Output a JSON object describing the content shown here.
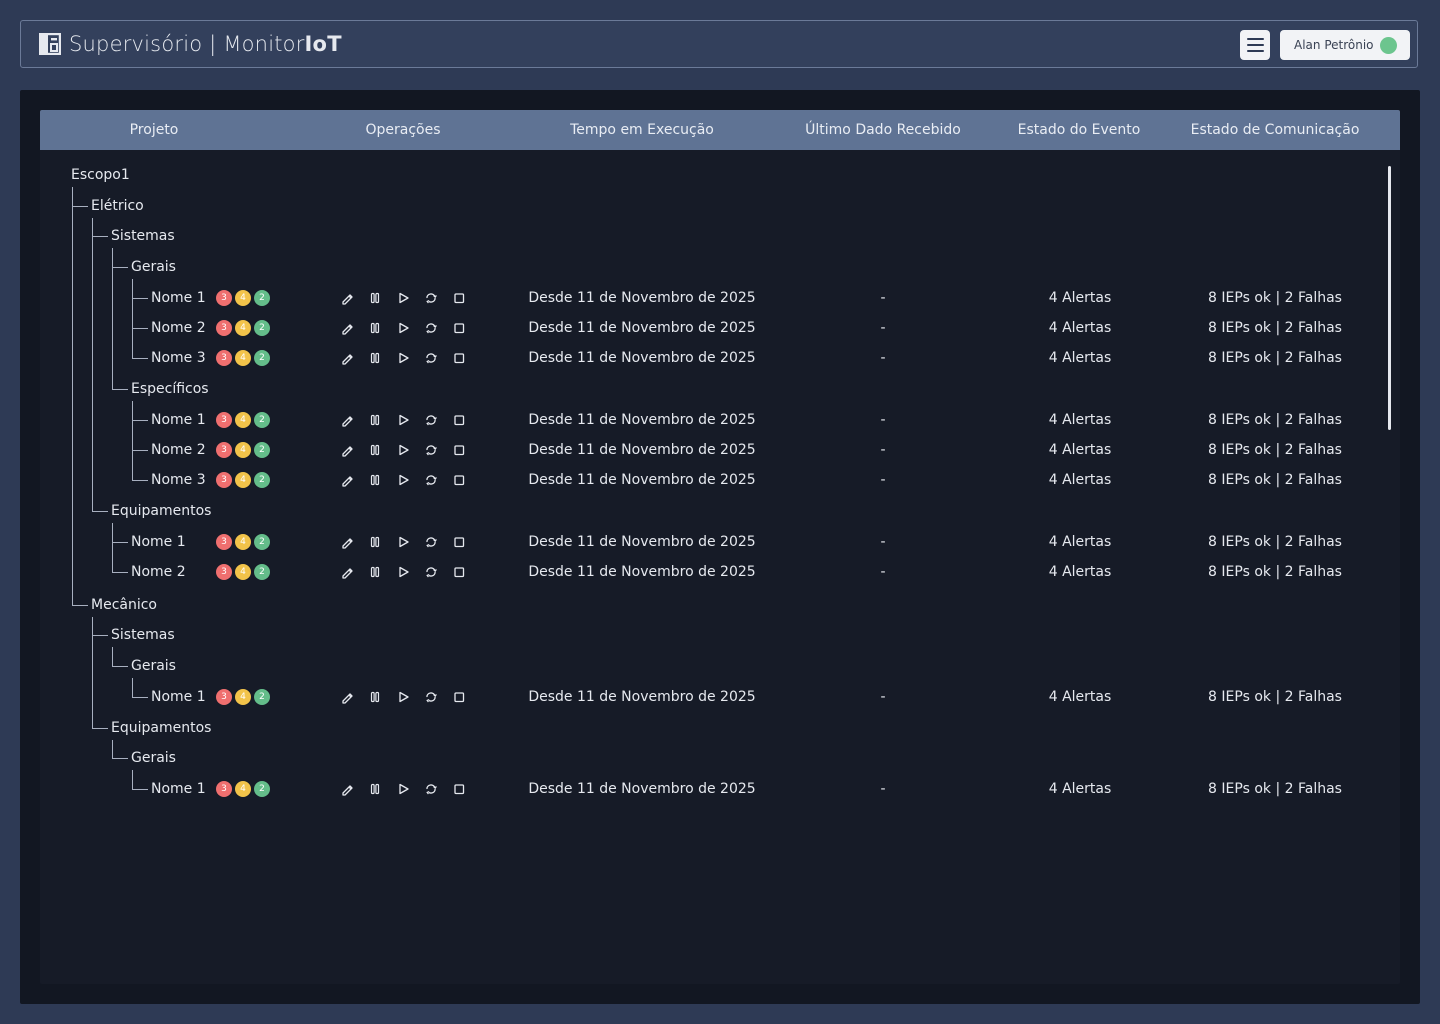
{
  "header": {
    "brand_light": "Supervisório | Monitor",
    "brand_bold": "IoT",
    "user_name": "Alan Petrônio"
  },
  "columns": [
    "Projeto",
    "Operações",
    "Tempo em Execução",
    "Último Dado Recebido",
    "Estado do Evento",
    "Estado de Comunicação"
  ],
  "colors": {
    "accent_header": "#5f7394",
    "status_red": "#ef6f6f",
    "status_yellow": "#f2c34a",
    "status_green": "#64bd8a"
  },
  "icons": [
    "edit-icon",
    "pause-icon",
    "play-icon",
    "refresh-icon",
    "stop-icon"
  ],
  "tree": {
    "name": "Escopo1",
    "children": [
      {
        "name": "Elétrico",
        "children": [
          {
            "name": "Sistemas",
            "children": [
              {
                "name": "Gerais",
                "children": [
                  {
                    "name": "Nome 1",
                    "badges": [
                      "3",
                      "4",
                      "2"
                    ],
                    "tempo": "Desde 11 de Novembro de 2025",
                    "ultimo": "-",
                    "evento": "4 Alertas",
                    "comunicacao": "8 IEPs ok | 2 Falhas"
                  },
                  {
                    "name": "Nome 2",
                    "badges": [
                      "3",
                      "4",
                      "2"
                    ],
                    "tempo": "Desde 11 de Novembro de 2025",
                    "ultimo": "-",
                    "evento": "4 Alertas",
                    "comunicacao": "8 IEPs ok | 2 Falhas"
                  },
                  {
                    "name": "Nome 3",
                    "badges": [
                      "3",
                      "4",
                      "2"
                    ],
                    "tempo": "Desde 11 de Novembro de 2025",
                    "ultimo": "-",
                    "evento": "4 Alertas",
                    "comunicacao": "8 IEPs ok | 2 Falhas"
                  }
                ]
              },
              {
                "name": "Específicos",
                "children": [
                  {
                    "name": "Nome 1",
                    "badges": [
                      "3",
                      "4",
                      "2"
                    ],
                    "tempo": "Desde 11 de Novembro de 2025",
                    "ultimo": "-",
                    "evento": "4 Alertas",
                    "comunicacao": "8 IEPs ok | 2 Falhas"
                  },
                  {
                    "name": "Nome 2",
                    "badges": [
                      "3",
                      "4",
                      "2"
                    ],
                    "tempo": "Desde 11 de Novembro de 2025",
                    "ultimo": "-",
                    "evento": "4 Alertas",
                    "comunicacao": "8 IEPs ok | 2 Falhas"
                  },
                  {
                    "name": "Nome 3",
                    "badges": [
                      "3",
                      "4",
                      "2"
                    ],
                    "tempo": "Desde 11 de Novembro de 2025",
                    "ultimo": "-",
                    "evento": "4 Alertas",
                    "comunicacao": "8 IEPs ok | 2 Falhas"
                  }
                ]
              }
            ]
          },
          {
            "name": "Equipamentos",
            "children": [
              {
                "name": "Nome 1",
                "badges": [
                  "3",
                  "4",
                  "2"
                ],
                "tempo": "Desde 11 de Novembro de 2025",
                "ultimo": "-",
                "evento": "4 Alertas",
                "comunicacao": "8 IEPs ok | 2 Falhas"
              },
              {
                "name": "Nome 2",
                "badges": [
                  "3",
                  "4",
                  "2"
                ],
                "tempo": "Desde 11 de Novembro de 2025",
                "ultimo": "-",
                "evento": "4 Alertas",
                "comunicacao": "8 IEPs ok | 2 Falhas"
              }
            ]
          }
        ]
      },
      {
        "name": "Mecânico",
        "children": [
          {
            "name": "Sistemas",
            "children": [
              {
                "name": "Gerais",
                "children": [
                  {
                    "name": "Nome 1",
                    "badges": [
                      "3",
                      "4",
                      "2"
                    ],
                    "tempo": "Desde 11 de Novembro de 2025",
                    "ultimo": "-",
                    "evento": "4 Alertas",
                    "comunicacao": "8 IEPs ok | 2 Falhas"
                  }
                ]
              }
            ]
          },
          {
            "name": "Equipamentos",
            "children": [
              {
                "name": "Gerais",
                "children": [
                  {
                    "name": "Nome 1",
                    "badges": [
                      "3",
                      "4",
                      "2"
                    ],
                    "tempo": "Desde 11 de Novembro de 2025",
                    "ultimo": "-",
                    "evento": "4 Alertas",
                    "comunicacao": "8 IEPs ok | 2 Falhas"
                  }
                ]
              }
            ]
          }
        ]
      }
    ]
  }
}
